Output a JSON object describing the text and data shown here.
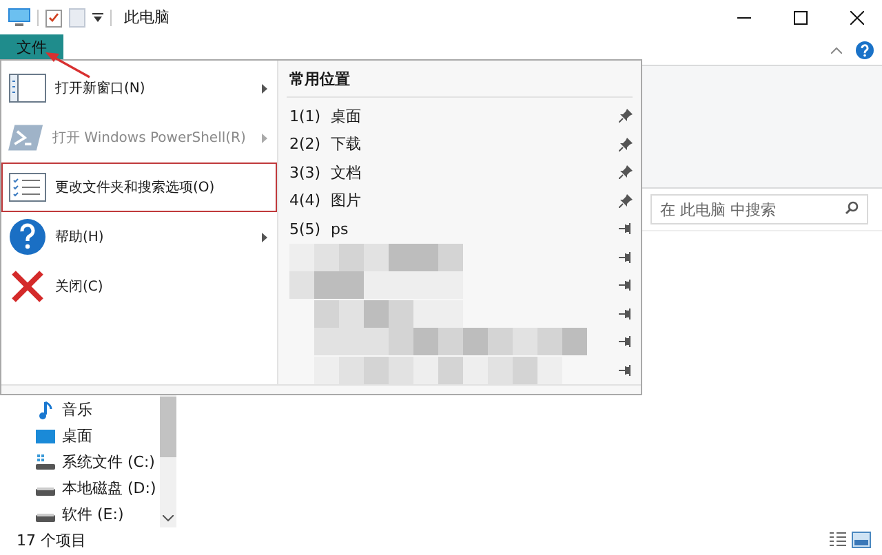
{
  "window": {
    "title": "此电脑"
  },
  "search": {
    "placeholder": "在 此电脑 中搜索"
  },
  "navigation": [
    {
      "label": "音乐",
      "kind": "music"
    },
    {
      "label": "桌面",
      "kind": "desktop"
    },
    {
      "label": "系统文件 (C:)",
      "kind": "system-drive"
    },
    {
      "label": "本地磁盘 (D:)",
      "kind": "drive"
    },
    {
      "label": "软件 (E:)",
      "kind": "drive"
    }
  ],
  "status_bar": {
    "item_count": "17 个项目"
  },
  "file_menu": {
    "tab": "文件",
    "items": [
      {
        "label": "打开新窗口(N)",
        "kind": "new-window",
        "submenu": true,
        "disabled": false,
        "highlighted": false
      },
      {
        "label": "打开 Windows PowerShell(R)",
        "kind": "powershell",
        "submenu": true,
        "disabled": true,
        "highlighted": false
      },
      {
        "label": "更改文件夹和搜索选项(O)",
        "kind": "options",
        "submenu": false,
        "disabled": false,
        "highlighted": true
      },
      {
        "label": "帮助(H)",
        "kind": "help",
        "submenu": true,
        "disabled": false,
        "highlighted": false
      },
      {
        "label": "关闭(C)",
        "kind": "close",
        "submenu": false,
        "disabled": false,
        "highlighted": false
      }
    ],
    "recent_header": "常用位置",
    "recent": [
      {
        "kind": "place",
        "number": "1(1)",
        "label": "桌面",
        "pinned": true
      },
      {
        "kind": "place",
        "number": "2(2)",
        "label": "下载",
        "pinned": true
      },
      {
        "kind": "place",
        "number": "3(3)",
        "label": "文档",
        "pinned": true
      },
      {
        "kind": "place",
        "number": "4(4)",
        "label": "图片",
        "pinned": true
      },
      {
        "kind": "place",
        "number": "5(5)",
        "label": "ps",
        "pinned": false
      },
      {
        "kind": "redacted",
        "pinned": false
      },
      {
        "kind": "redacted",
        "pinned": false
      },
      {
        "kind": "redacted",
        "pinned": false
      },
      {
        "kind": "redacted",
        "pinned": false
      },
      {
        "kind": "redacted",
        "pinned": false
      }
    ]
  }
}
